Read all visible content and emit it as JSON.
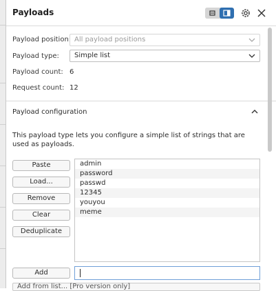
{
  "panel": {
    "title": "Payloads",
    "layout_toggle": {
      "icons": [
        "list-layout-icon",
        "split-layout-icon"
      ]
    },
    "settings_icon": "gear-icon",
    "close_icon": "close-icon"
  },
  "fields": {
    "payload_position_label": "Payload position:",
    "payload_position_value": "All payload positions",
    "payload_type_label": "Payload type:",
    "payload_type_value": "Simple list",
    "payload_count_label": "Payload count:",
    "payload_count_value": "6",
    "request_count_label": "Request count:",
    "request_count_value": "12"
  },
  "configuration": {
    "title": "Payload configuration",
    "description": "This payload type lets you configure a simple list of strings that are used as payloads.",
    "buttons": {
      "paste": "Paste",
      "load": "Load...",
      "remove": "Remove",
      "clear": "Clear",
      "deduplicate": "Deduplicate",
      "add": "Add"
    },
    "items": [
      "admin",
      "password",
      "passwd",
      "12345",
      "youyou",
      "meme"
    ],
    "add_input_value": "",
    "bottom_select_text": "Add from list... [Pro version only]"
  },
  "colors": {
    "accent": "#2f6fb0",
    "input_focus": "#6f9fd8"
  }
}
